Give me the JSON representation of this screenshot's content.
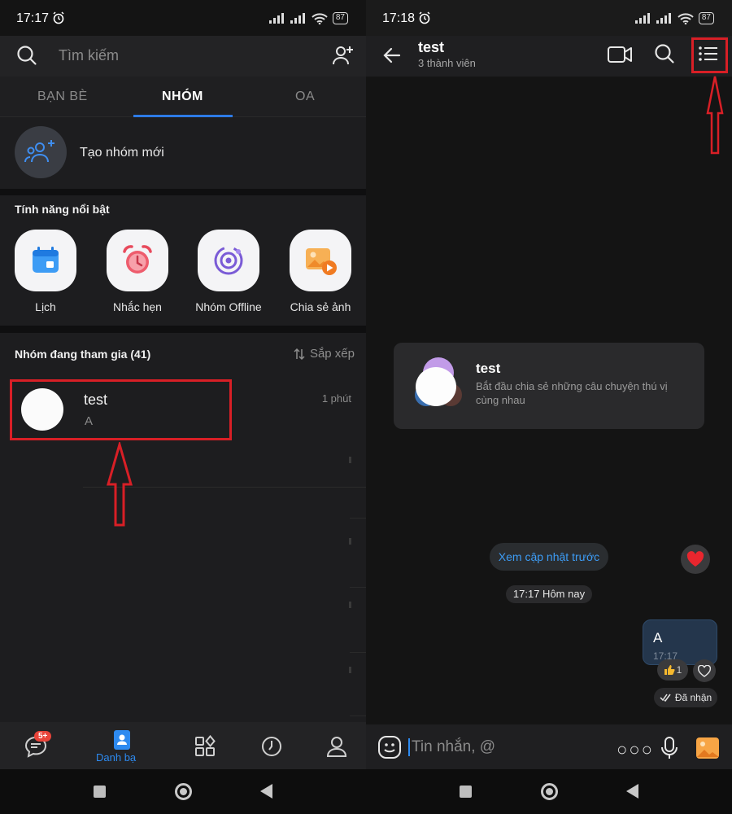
{
  "left": {
    "status": {
      "time": "17:17",
      "battery": "87"
    },
    "search": {
      "placeholder": "Tìm kiếm"
    },
    "tabs": [
      {
        "label": "BẠN BÈ"
      },
      {
        "label": "NHÓM"
      },
      {
        "label": "OA"
      }
    ],
    "active_tab": "NHÓM",
    "create_group": {
      "label": "Tạo nhóm mới"
    },
    "features": {
      "title": "Tính năng nổi bật",
      "items": [
        {
          "label": "Lịch",
          "icon": "calendar-icon"
        },
        {
          "label": "Nhắc hẹn",
          "icon": "alarm-clock-icon"
        },
        {
          "label": "Nhóm Offline",
          "icon": "orbit-icon"
        },
        {
          "label": "Chia sẻ ảnh",
          "icon": "photo-share-icon"
        }
      ]
    },
    "groups": {
      "title": "Nhóm đang tham gia (41)",
      "sort_label": "Sắp xếp",
      "items": [
        {
          "name": "test",
          "last_message": "A",
          "time": "1 phút"
        }
      ]
    },
    "bottom_nav": {
      "badge": "5+",
      "active_label": "Danh bạ",
      "active_color": "#2d8af0"
    }
  },
  "right": {
    "status": {
      "time": "17:18",
      "battery": "87"
    },
    "header": {
      "title": "test",
      "subtitle": "3 thành viên"
    },
    "intro_card": {
      "title": "test",
      "description": "Bắt đầu chia sẻ những câu chuyện thú vị cùng nhau"
    },
    "load_previous_label": "Xem cập nhật trước",
    "timestamp_label": "17:17 Hôm nay",
    "message": {
      "text": "A",
      "time": "17:17",
      "like_count": "1"
    },
    "receipt_label": "Đã nhận",
    "input": {
      "placeholder": "Tin nhắn, @"
    }
  },
  "colors": {
    "highlight": "#d81f26",
    "accent": "#2d7ae6"
  }
}
